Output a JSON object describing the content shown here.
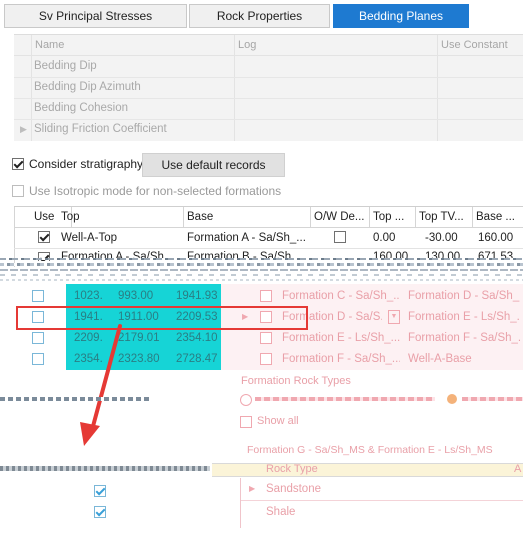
{
  "tabs": [
    {
      "label": "Sv Principal Stresses",
      "active": false
    },
    {
      "label": "Rock Properties",
      "active": false
    },
    {
      "label": "Bedding Planes",
      "active": true
    }
  ],
  "prop_grid": {
    "col_name": "Name",
    "col_log": "Log",
    "col_use_constant": "Use Constant",
    "rows": [
      "Bedding Dip",
      "Bedding Dip Azimuth",
      "Bedding Cohesion",
      "Sliding Friction Coefficient"
    ]
  },
  "stratigraphy": {
    "consider_label": "Consider stratigraphy",
    "consider_checked": true,
    "default_button": "Use default records",
    "isotropic_label": "Use Isotropic mode for non-selected formations",
    "isotropic_checked": false
  },
  "table": {
    "headers": [
      "Use",
      "Top",
      "Base",
      "O/W De...",
      "Top ...",
      "Top TV...",
      "Base ..."
    ],
    "rows": [
      {
        "use": true,
        "top": "Well-A-Top",
        "base": "Formation A - Sa/Sh_...",
        "ow": false,
        "top_md": "0.00",
        "top_tvd": "-30.00",
        "base_md": "160.00"
      },
      {
        "use": true,
        "top": "Formation A - Sa/Sh...",
        "base": "Formation B - Sa/Sh_...",
        "ow": false,
        "top_md": "160.00",
        "top_tvd": "130.00",
        "base_md": "671.53"
      }
    ]
  },
  "glitch_rows": [
    {
      "v1": "1023.",
      "v2": "993.00",
      "v3": "1941.93",
      "top": "Formation C - Sa/Sh_...",
      "base": "Formation D - Sa/Sh_"
    },
    {
      "v1": "1941.",
      "v2": "1911.00",
      "v3": "2209.53",
      "top": "Formation D - Sa/S...",
      "base": "Formation E - Ls/Sh_..."
    },
    {
      "v1": "2209.",
      "v2": "2179.01",
      "v3": "2354.10",
      "top": "Formation E - Ls/Sh_...",
      "base": "Formation F - Sa/Sh_..."
    },
    {
      "v1": "2354.",
      "v2": "2323.80",
      "v3": "2728.47",
      "top": "Formation F - Sa/Sh_...",
      "base": "Well-A-Base"
    }
  ],
  "rock_types": {
    "title": "Formation Rock Types",
    "show_all_label": "Show all",
    "group_label": "Formation G - Sa/Sh_MS & Formation E - Ls/Sh_MS",
    "col_rock_type": "Rock Type",
    "col_extra": "A",
    "items": [
      "Sandstone",
      "Shale"
    ]
  },
  "colors": {
    "tab_active": "#1e7ad1",
    "glitch_teal": "#16d4d6",
    "highlight_red": "#e53935",
    "pink_text": "#e9a0a8"
  }
}
